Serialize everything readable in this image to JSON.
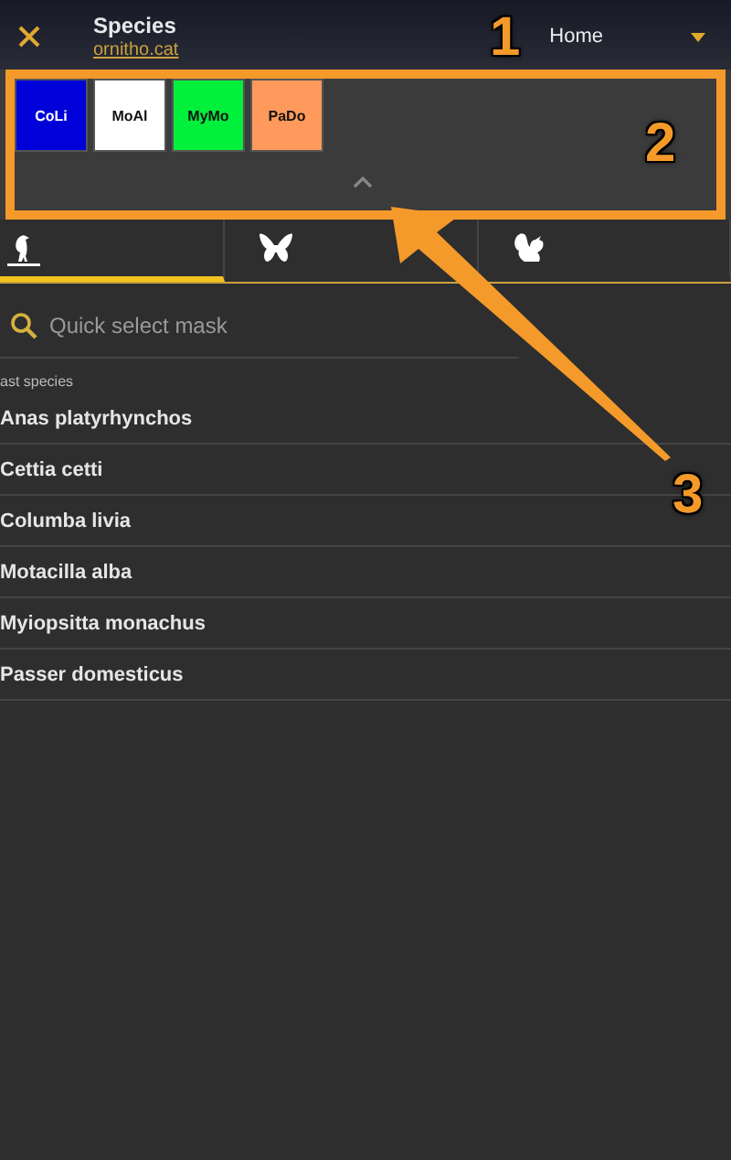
{
  "header": {
    "title": "Species",
    "subtitle": "ornitho.cat",
    "location": "Home"
  },
  "masks": [
    {
      "label": "CoLi",
      "color": "#0000d8"
    },
    {
      "label": "MoAl",
      "color": "#ffffff"
    },
    {
      "label": "MyMo",
      "color": "#00f03c"
    },
    {
      "label": "PaDo",
      "color": "#ff9a5c"
    }
  ],
  "tabs": [
    {
      "kind": "bird",
      "selected": true
    },
    {
      "kind": "butterfly",
      "selected": false
    },
    {
      "kind": "squirrel",
      "selected": false
    }
  ],
  "search": {
    "placeholder": "Quick select mask"
  },
  "list": {
    "heading": "ast species",
    "items": [
      "Anas platyrhynchos",
      "Cettia cetti",
      "Columba livia",
      "Motacilla alba",
      "Myiopsitta monachus",
      "Passer domesticus"
    ]
  },
  "annotations": [
    {
      "kind": "marker",
      "label": "1"
    },
    {
      "kind": "box",
      "label": "2"
    },
    {
      "kind": "arrow",
      "label": "3"
    }
  ]
}
